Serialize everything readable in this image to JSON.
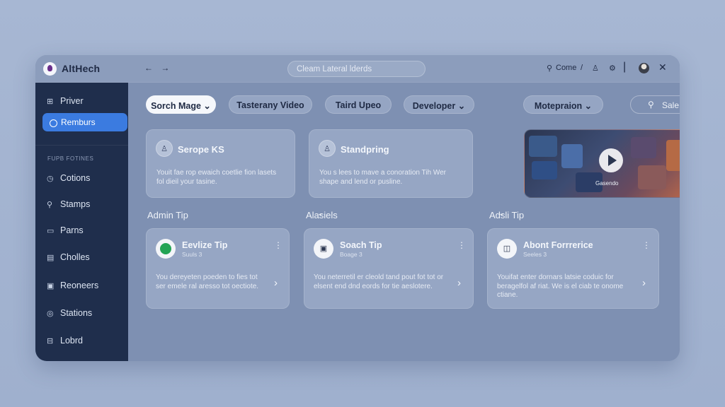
{
  "app": {
    "title": "AltHech",
    "nav_arrows": "← →",
    "search_placeholder": "Cleam Lateral lderds",
    "toolbar": {
      "come_label": "Come",
      "slash": "/",
      "close_glyph": "✕"
    }
  },
  "sidebar": {
    "top_items": [
      {
        "label": "Priver",
        "icon": "grid-icon",
        "glyph": "⊞"
      },
      {
        "label": "Remburs",
        "icon": "circle-icon",
        "active": true
      }
    ],
    "section_label": "FUPB FOTINES",
    "items": [
      {
        "label": "Cotions",
        "icon": "clock-icon",
        "glyph": "◷"
      },
      {
        "label": "Stamps",
        "icon": "user-icon",
        "glyph": "⚲"
      },
      {
        "label": "Parns",
        "icon": "window-icon",
        "glyph": "▭"
      },
      {
        "label": "Cholles",
        "icon": "document-icon",
        "glyph": "▤"
      },
      {
        "label": "Reoneers",
        "icon": "clipboard-icon",
        "glyph": "▣"
      },
      {
        "label": "Stations",
        "icon": "globe-icon",
        "glyph": "◎"
      },
      {
        "label": "Lobrd",
        "icon": "cart-icon",
        "glyph": "⊟"
      }
    ]
  },
  "filters": [
    {
      "label": "Sorch Mage",
      "has_dropdown": true,
      "selected": true
    },
    {
      "label": "Tasterany Video",
      "has_dropdown": false
    },
    {
      "label": "Taird Upeo",
      "has_dropdown": false
    },
    {
      "label": "Developer",
      "has_dropdown": true
    },
    {
      "label": "Motepraion",
      "has_dropdown": true
    }
  ],
  "search_button": {
    "label": "Sale"
  },
  "top_cards": [
    {
      "title": "Serope KS",
      "icon": "person-icon",
      "body": "Youit fae rop ewaich coetlie fion lasets fol dieil your tasine."
    },
    {
      "title": "Standpring",
      "icon": "person-icon",
      "body": "You s lees to mave a conoration Tih Wer shape and lend or pusline."
    }
  ],
  "media_card": {
    "caption": "Gasendo",
    "icon": "play-icon"
  },
  "sections": [
    {
      "heading": "Admin Tip"
    },
    {
      "heading": "Alasiels"
    },
    {
      "heading": "Adsli Tip"
    }
  ],
  "tip_cards": [
    {
      "title": "Eevlize Tip",
      "subtitle": "Suuls 3",
      "icon": "green-circle-icon",
      "body": "You dereyeten poeden to fies tot ser emele ral aresso tot oectiote."
    },
    {
      "title": "Soach Tip",
      "subtitle": "Boage 3",
      "icon": "clipboard-icon",
      "body": "You neterretil er cleold tand pout fot tot or elsent end dnd eords for tie aeslotere."
    },
    {
      "title": "Abont Forrrerice",
      "subtitle": "Seeles 3",
      "icon": "chat-icon",
      "body": "Youifat enter dornars latsie coduic for beragelfol af riat. We is el ciab te onome ctiane."
    }
  ]
}
